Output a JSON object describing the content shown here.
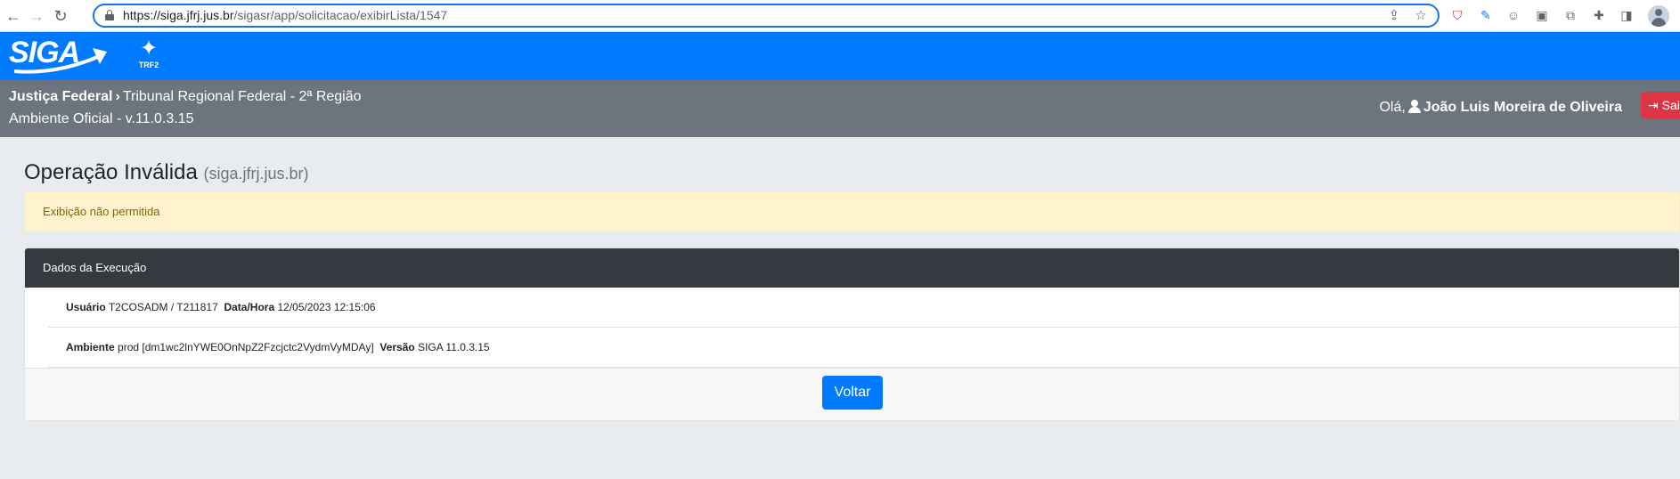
{
  "browser": {
    "url_host": "https://siga.jfrj.jus.br",
    "url_path": "/sigasr/app/solicitacao/exibirLista/1547",
    "back_icon": "←",
    "forward_icon": "→",
    "reload_icon": "↻",
    "share_icon": "⇪",
    "star_icon": "☆",
    "ext_icons": [
      "⛉",
      "✎",
      "☺",
      "▣",
      "⧉",
      "✚",
      "◨"
    ]
  },
  "header": {
    "logo_text": "SIGA",
    "trf_star": "✦",
    "trf_label": "TRF2"
  },
  "subheader": {
    "crumb_root": "Justiça Federal",
    "crumb_sep": "›",
    "crumb_current": "Tribunal Regional Federal - 2ª Região",
    "environment": "Ambiente Oficial - v.11.0.3.15",
    "greeting": "Olá,",
    "user_name": "João Luis Moreira de Oliveira",
    "logout_label": "⇥ Sair"
  },
  "main": {
    "title": "Operação Inválida",
    "title_sub": "(siga.jfrj.jus.br)",
    "alert": "Exibição não permitida",
    "card": {
      "header": "Dados da Execução",
      "rows": [
        {
          "label1": "Usuário",
          "value1": "T2COSADM / T211817",
          "label2": "Data/Hora",
          "value2": "12/05/2023 12:15:06"
        },
        {
          "label1": "Ambiente",
          "value1": "prod [dm1wc2lnYWE0OnNpZ2Fzcjctc2VydmVyMDAy]",
          "label2": "Versão",
          "value2": "SIGA 11.0.3.15"
        }
      ],
      "button": "Voltar"
    }
  },
  "colors": {
    "primary": "#007bff",
    "header_gray": "#6c757d",
    "danger": "#dc3545",
    "alert_bg": "#fff3cd",
    "card_header": "#343a40"
  }
}
